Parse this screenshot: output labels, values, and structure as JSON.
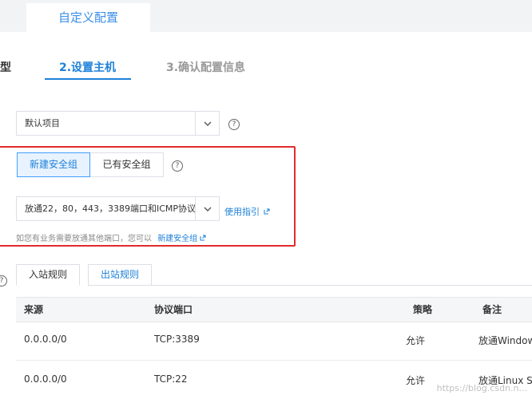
{
  "top_tabs": {
    "custom_config": "自定义配置"
  },
  "steps": {
    "step1_fragment": "型",
    "step2": "2.设置主机",
    "step3": "3.确认配置信息"
  },
  "project_select": {
    "value": "默认项目"
  },
  "security_group": {
    "new_button": "新建安全组",
    "existing_button": "已有安全组",
    "template_value": "放通22，80，443，3389端口和ICMP协议",
    "guide_link": "使用指引",
    "note_text": "如您有业务需要放通其他端口，您可以",
    "note_link": "新建安全组"
  },
  "rule_tabs": {
    "inbound": "入站规则",
    "outbound": "出站规则"
  },
  "table": {
    "headers": {
      "source": "来源",
      "protocol_port": "协议端口",
      "policy": "策略",
      "remark": "备注"
    },
    "rows": [
      {
        "source": "0.0.0.0/0",
        "protocol_port": "TCP:3389",
        "policy": "允许",
        "remark": "放通Window"
      },
      {
        "source": "0.0.0.0/0",
        "protocol_port": "TCP:22",
        "policy": "允许",
        "remark": "放通Linux S"
      }
    ]
  },
  "help_glyph": "?",
  "watermark": "https://blog.csdn.n..."
}
